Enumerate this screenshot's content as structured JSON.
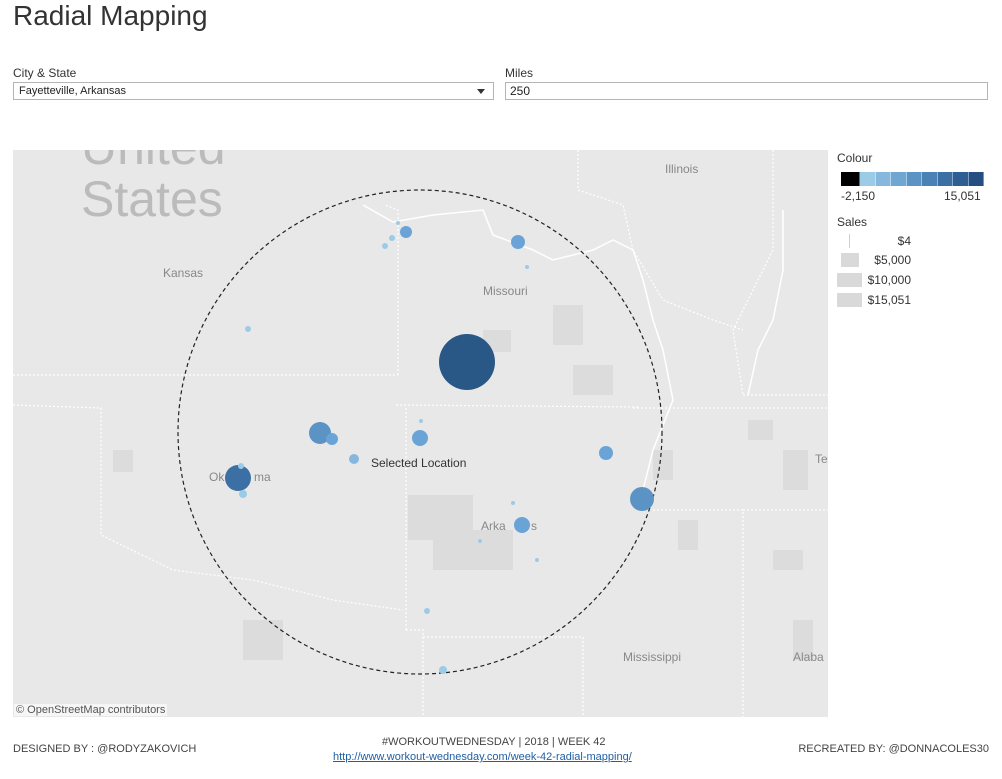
{
  "title": "Radial Mapping",
  "filters": {
    "city_label": "City & State",
    "city_value": "Fayetteville, Arkansas",
    "miles_label": "Miles",
    "miles_value": "250"
  },
  "map": {
    "labels": {
      "country_line1": "United",
      "country_line2": "States",
      "kansas": "Kansas",
      "missouri": "Missouri",
      "illinois": "Illinois",
      "oklahoma_part1": "Ok",
      "oklahoma_part2": "ma",
      "arkansas_part1": "Arka",
      "arkansas_part2": "s",
      "mississippi": "Mississippi",
      "alabama_partial": "Alaba",
      "tennessee_partial": "Te",
      "selected_location": "Selected Location"
    },
    "attribution": "© OpenStreetMap contributors"
  },
  "legend": {
    "colour_title": "Colour",
    "colour_min": "-2,150",
    "colour_max": "15,051",
    "colour_steps": [
      "#000000",
      "#9ccbe8",
      "#86b8de",
      "#70a6d2",
      "#5b94c4",
      "#4a82b6",
      "#3c70a5",
      "#2f5e93",
      "#254f81"
    ],
    "sales_title": "Sales",
    "sales_entries": [
      "$4",
      "$5,000",
      "$10,000",
      "$15,051"
    ]
  },
  "footer": {
    "designed_by": "DESIGNED BY : @RODYZAKOVICH",
    "center_line": "#WORKOUTWEDNESDAY  |  2018  |  WEEK 42",
    "link": "http://www.workout-wednesday.com/week-42-radial-mapping/",
    "recreated_by": "RECREATED BY: @DONNACOLES30"
  }
}
